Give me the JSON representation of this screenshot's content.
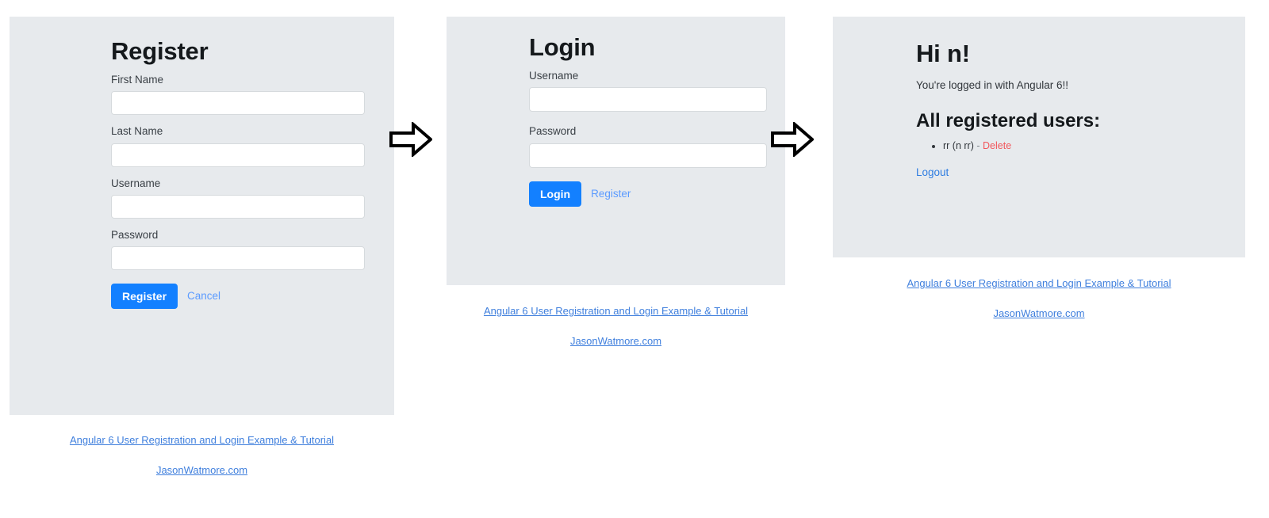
{
  "colors": {
    "panel_bg": "#e7eaed",
    "primary": "#1380ff",
    "link": "#5b9bff",
    "link_footer": "#3f7fdd",
    "danger": "#f2565b",
    "text": "#31363b",
    "heading": "#15191c",
    "page_bg": "#ffffff"
  },
  "register": {
    "heading": "Register",
    "fields": [
      {
        "label": "First Name",
        "value": "",
        "placeholder": "",
        "name": "first-name"
      },
      {
        "label": "Last Name",
        "value": "",
        "placeholder": "",
        "name": "last-name"
      },
      {
        "label": "Username",
        "value": "",
        "placeholder": "",
        "name": "username"
      },
      {
        "label": "Password",
        "value": "",
        "placeholder": "",
        "name": "password"
      }
    ],
    "submit_label": "Register",
    "cancel_label": "Cancel"
  },
  "login": {
    "heading": "Login",
    "fields": [
      {
        "label": "Username",
        "value": "",
        "placeholder": "",
        "name": "username"
      },
      {
        "label": "Password",
        "value": "",
        "placeholder": "",
        "name": "password"
      }
    ],
    "submit_label": "Login",
    "register_label": "Register"
  },
  "home": {
    "heading": "Hi n!",
    "lead": "You're logged in with Angular 6!!",
    "users_heading": "All registered users:",
    "users": [
      {
        "display": "rr (n rr)",
        "separator": "-",
        "delete_label": "Delete"
      }
    ],
    "logout_label": "Logout"
  },
  "arrows": [
    {
      "name": "arrow-register-to-login"
    },
    {
      "name": "arrow-login-to-home"
    }
  ],
  "footer": {
    "line1": "Angular 6 User Registration and Login Example & Tutorial",
    "line2": "JasonWatmore.com"
  }
}
